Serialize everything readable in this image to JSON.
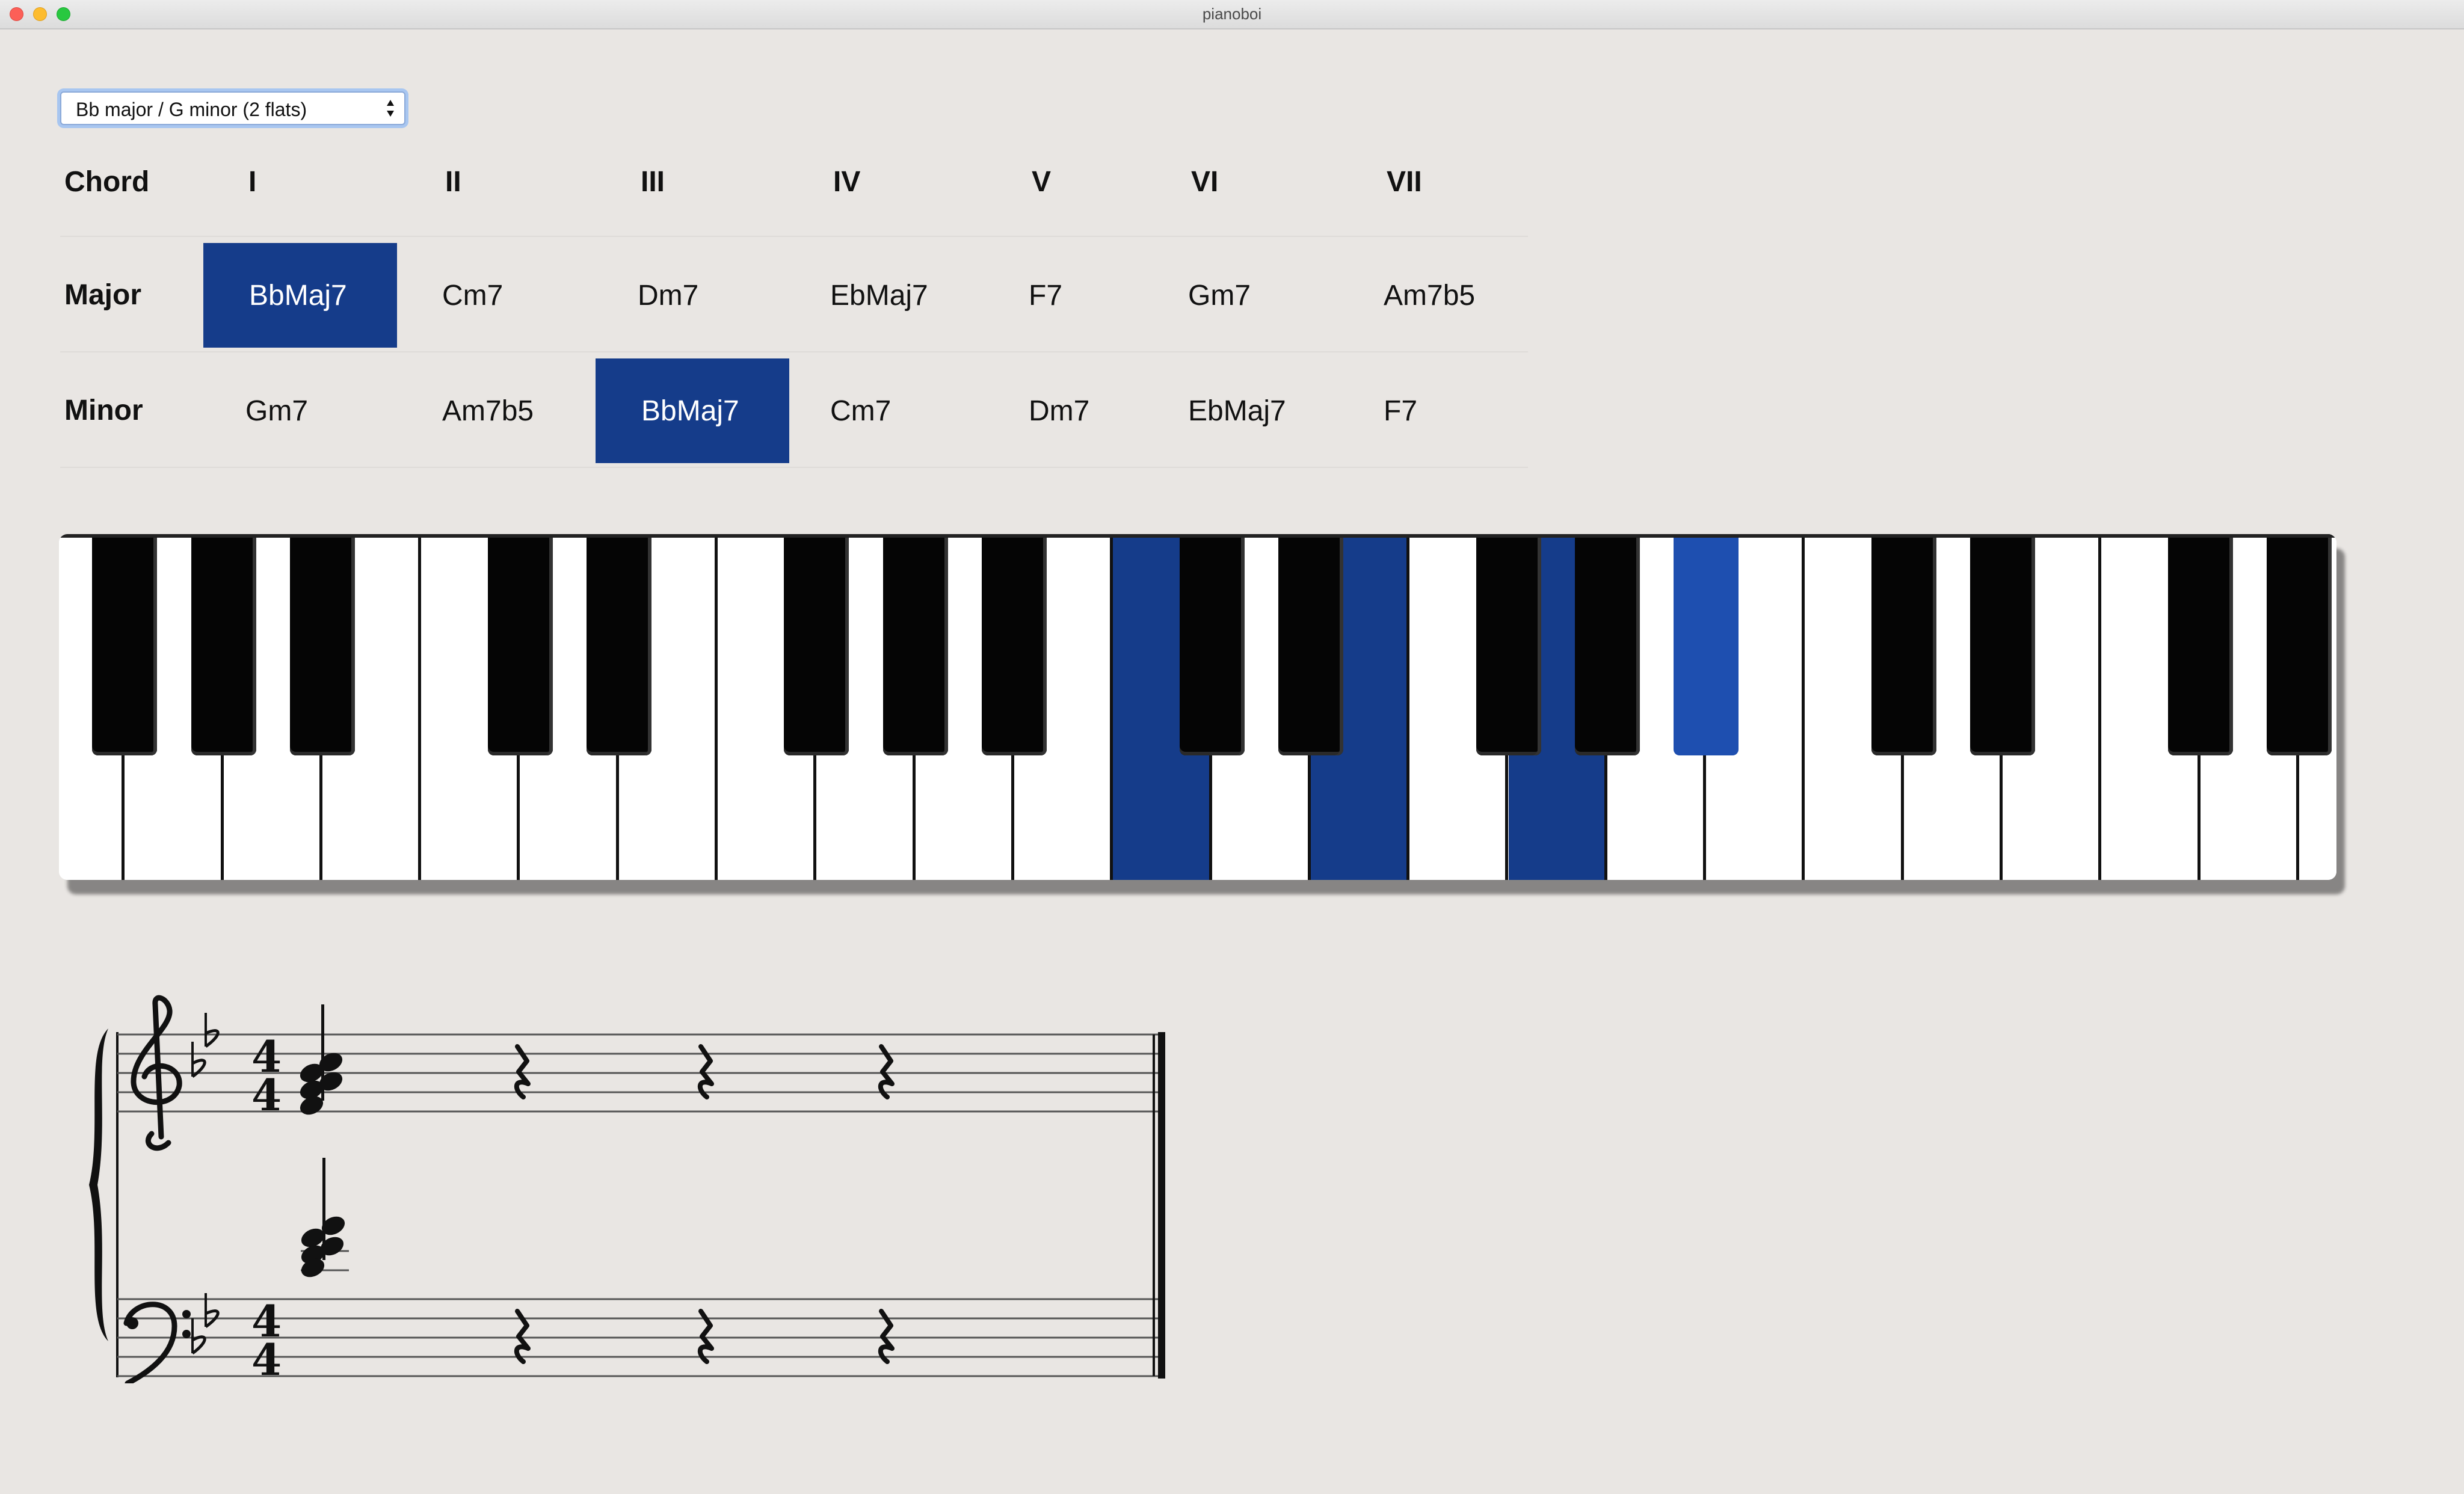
{
  "window": {
    "title": "pianoboi"
  },
  "key_select": {
    "value": "Bb major / G minor (2 flats)"
  },
  "chord_table": {
    "header_label": "Chord",
    "degrees": [
      "I",
      "II",
      "III",
      "IV",
      "V",
      "VI",
      "VII"
    ],
    "rows": [
      {
        "label": "Major",
        "chords": [
          "BbMaj7",
          "Cm7",
          "Dm7",
          "EbMaj7",
          "F7",
          "Gm7",
          "Am7b5"
        ],
        "selected_index": 0
      },
      {
        "label": "Minor",
        "chords": [
          "Gm7",
          "Am7b5",
          "BbMaj7",
          "Cm7",
          "Dm7",
          "EbMaj7",
          "F7"
        ],
        "selected_index": 2
      }
    ]
  },
  "keyboard": {
    "white_key_count": 23,
    "pressed_white_indices": [
      11,
      13,
      15
    ],
    "black_key_positions": [
      0,
      1,
      2,
      4,
      5,
      7,
      8,
      9,
      11,
      12,
      14,
      15,
      16,
      18,
      19,
      21,
      22
    ],
    "pressed_black_positions": [
      16
    ],
    "highlight_color": "#153c8a",
    "highlight_color_black": "#1e4fb0"
  },
  "score": {
    "key_signature": "2 flats",
    "time_signature": "4/4"
  },
  "colors": {
    "selected_bg": "#153c8a",
    "selected_fg": "#ffffff",
    "background": "#e9e6e3"
  }
}
